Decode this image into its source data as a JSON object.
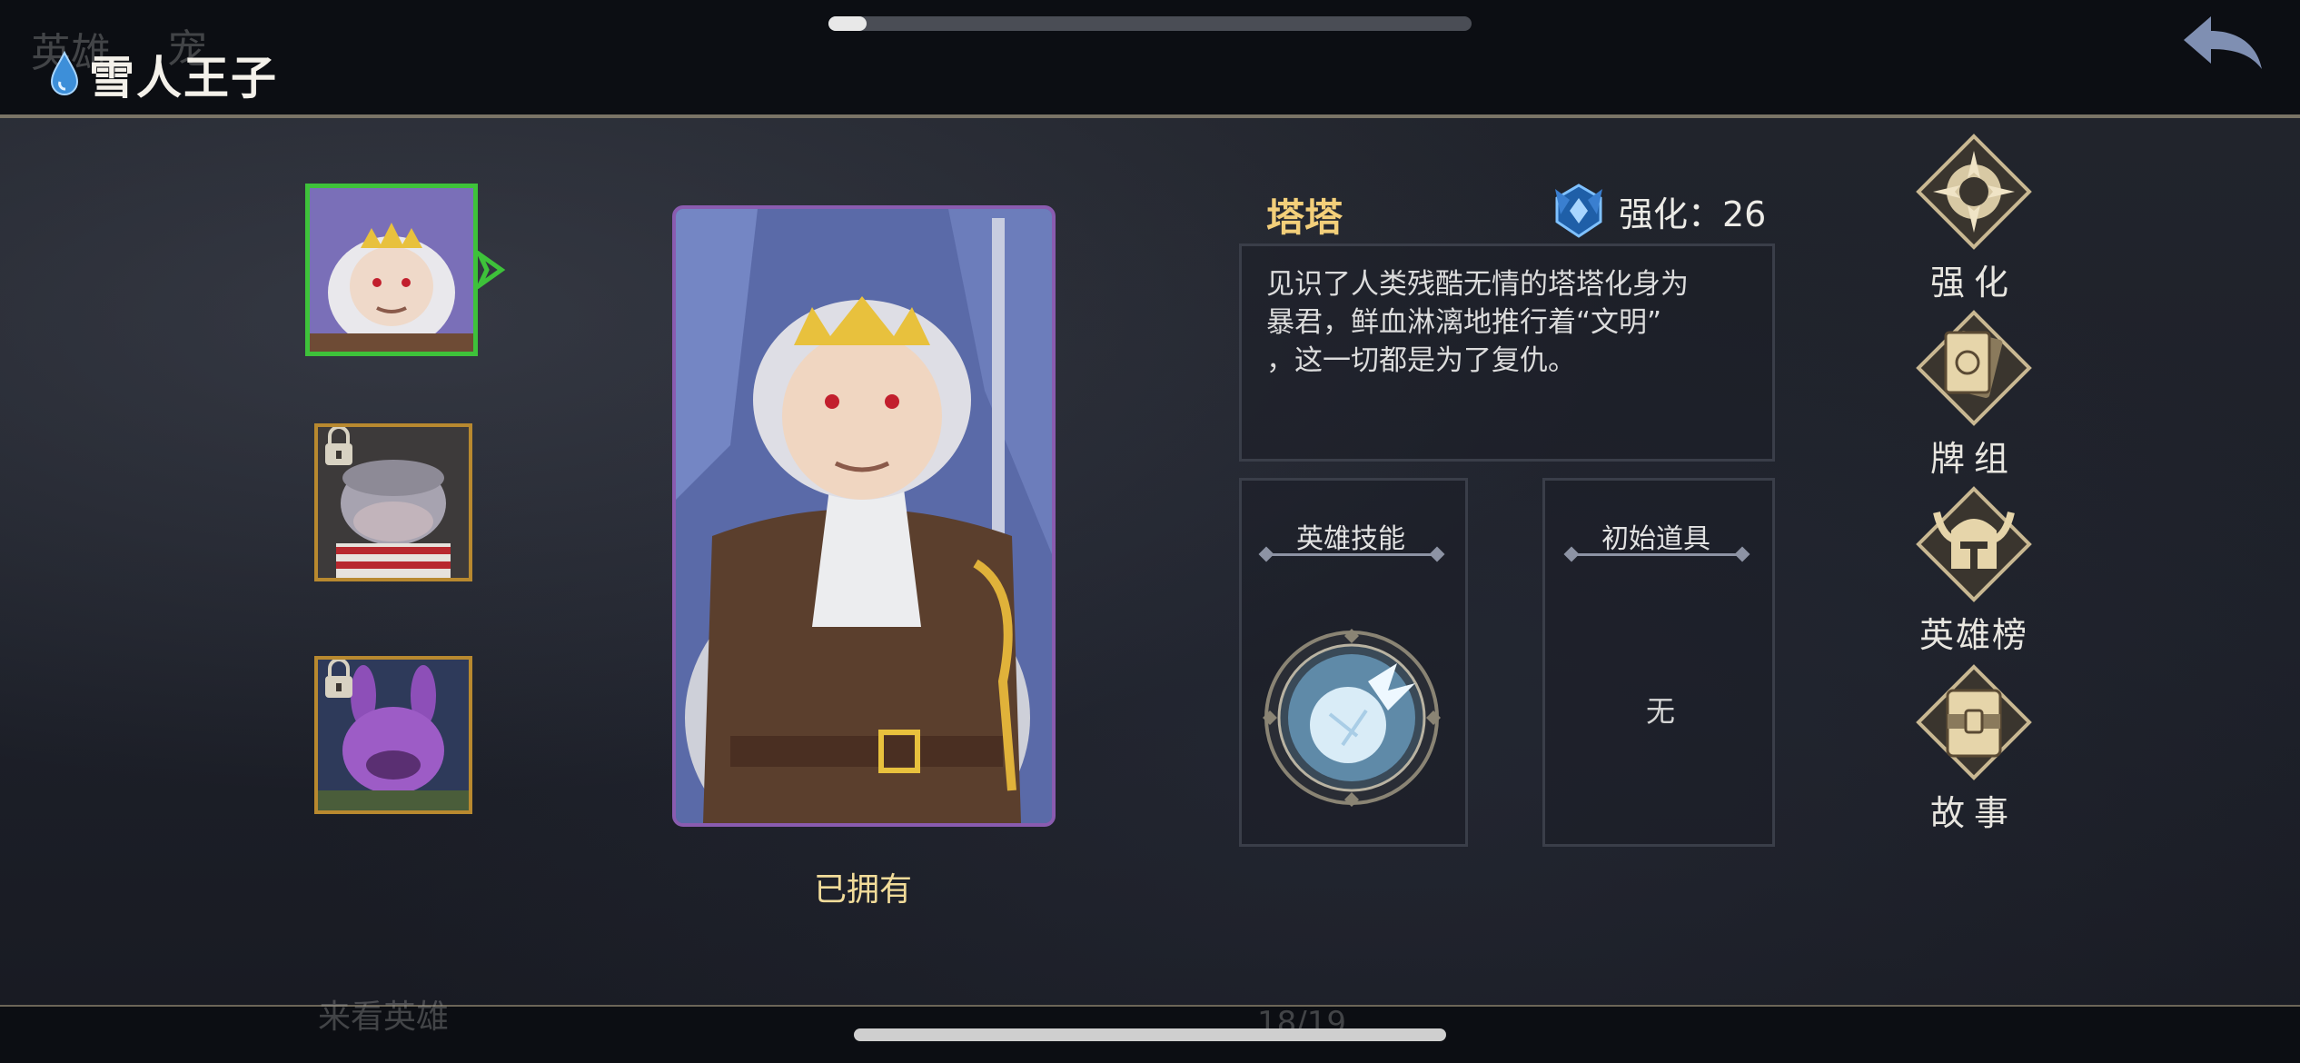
{
  "header": {
    "title": "雪人王子",
    "ghost_tab_1": "英雄",
    "ghost_tab_2": "宠"
  },
  "progress": {
    "value": 0.06
  },
  "heroes": [
    {
      "name": "portrait-hero-1",
      "locked": false,
      "selected": true
    },
    {
      "name": "portrait-hero-2",
      "locked": true,
      "selected": false
    },
    {
      "name": "portrait-hero-3",
      "locked": true,
      "selected": false
    }
  ],
  "card": {
    "status": "已拥有"
  },
  "hero": {
    "name": "塔塔",
    "enhance_label": "强化：26",
    "description_lines": [
      "见识了人类残酷无情的塔塔化身为",
      "暴君，鲜血淋漓地推行着“文明”",
      "，这一切都是为了复仇。"
    ]
  },
  "skill": {
    "title": "英雄技能"
  },
  "items": {
    "title": "初始道具",
    "value": "无"
  },
  "menu": {
    "enhance": "强化",
    "deck": "牌组",
    "rank": "英雄榜",
    "story": "故事"
  },
  "ghost_bottom": {
    "left": "来看英雄",
    "right": "18/19"
  },
  "colors": {
    "accent_gold": "#f3cf7a",
    "selected_green": "#3ec23a",
    "card_border": "#8a5cb0",
    "locked_border": "#b8892f"
  }
}
